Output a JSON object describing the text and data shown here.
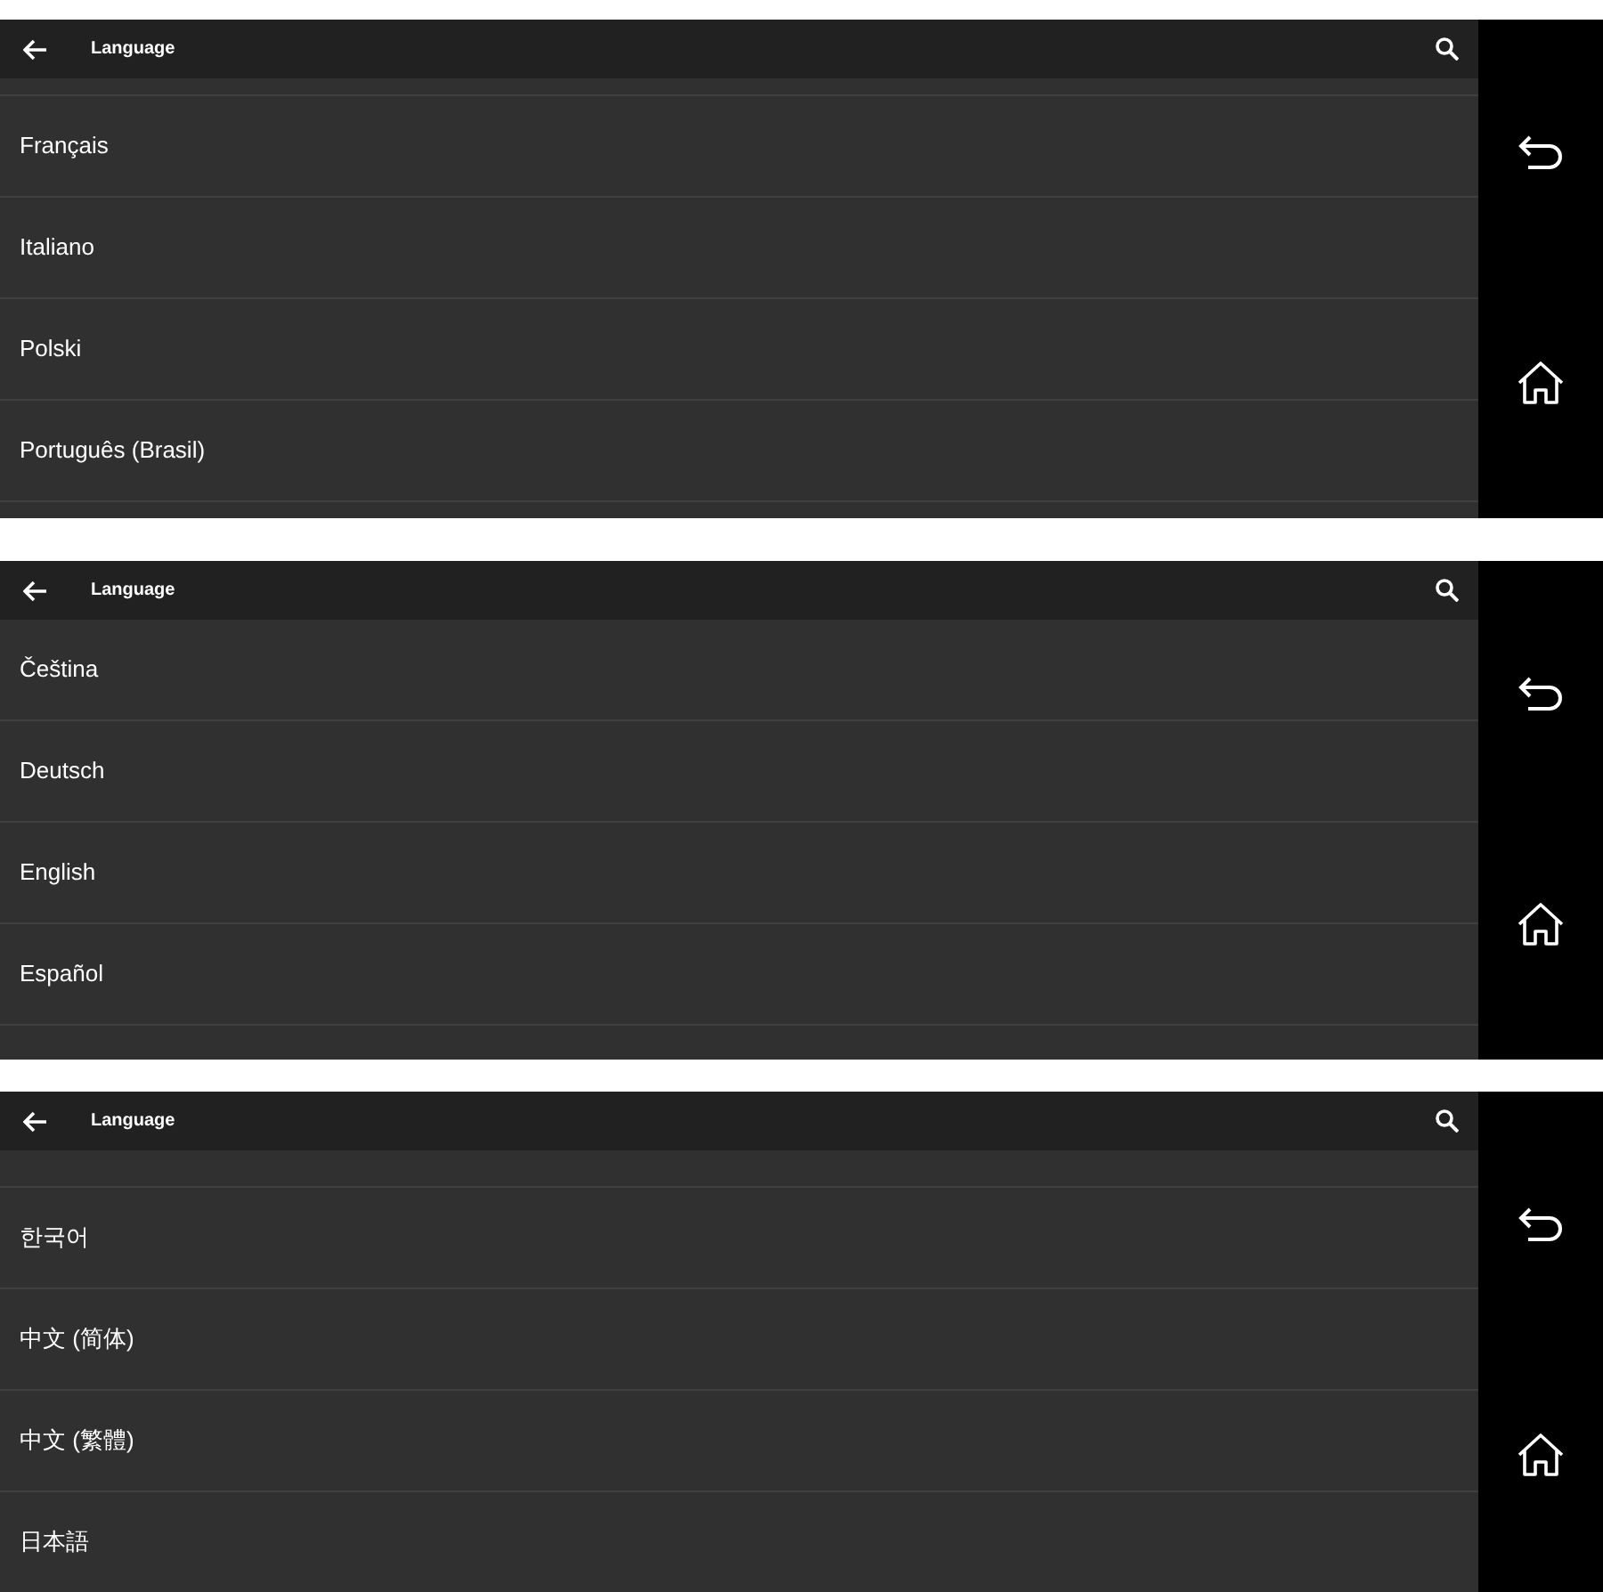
{
  "screens": [
    {
      "title": "Language",
      "items": [
        {
          "label": "Français"
        },
        {
          "label": "Italiano"
        },
        {
          "label": "Polski"
        },
        {
          "label": "Português (Brasil)"
        }
      ]
    },
    {
      "title": "Language",
      "items": [
        {
          "label": "Čeština"
        },
        {
          "label": "Deutsch"
        },
        {
          "label": "English"
        },
        {
          "label": "Español"
        }
      ]
    },
    {
      "title": "Language",
      "items": [
        {
          "label": "한국어"
        },
        {
          "label": "中文 (简体)"
        },
        {
          "label": "中文 (繁體)"
        },
        {
          "label": "日本語"
        }
      ]
    }
  ]
}
